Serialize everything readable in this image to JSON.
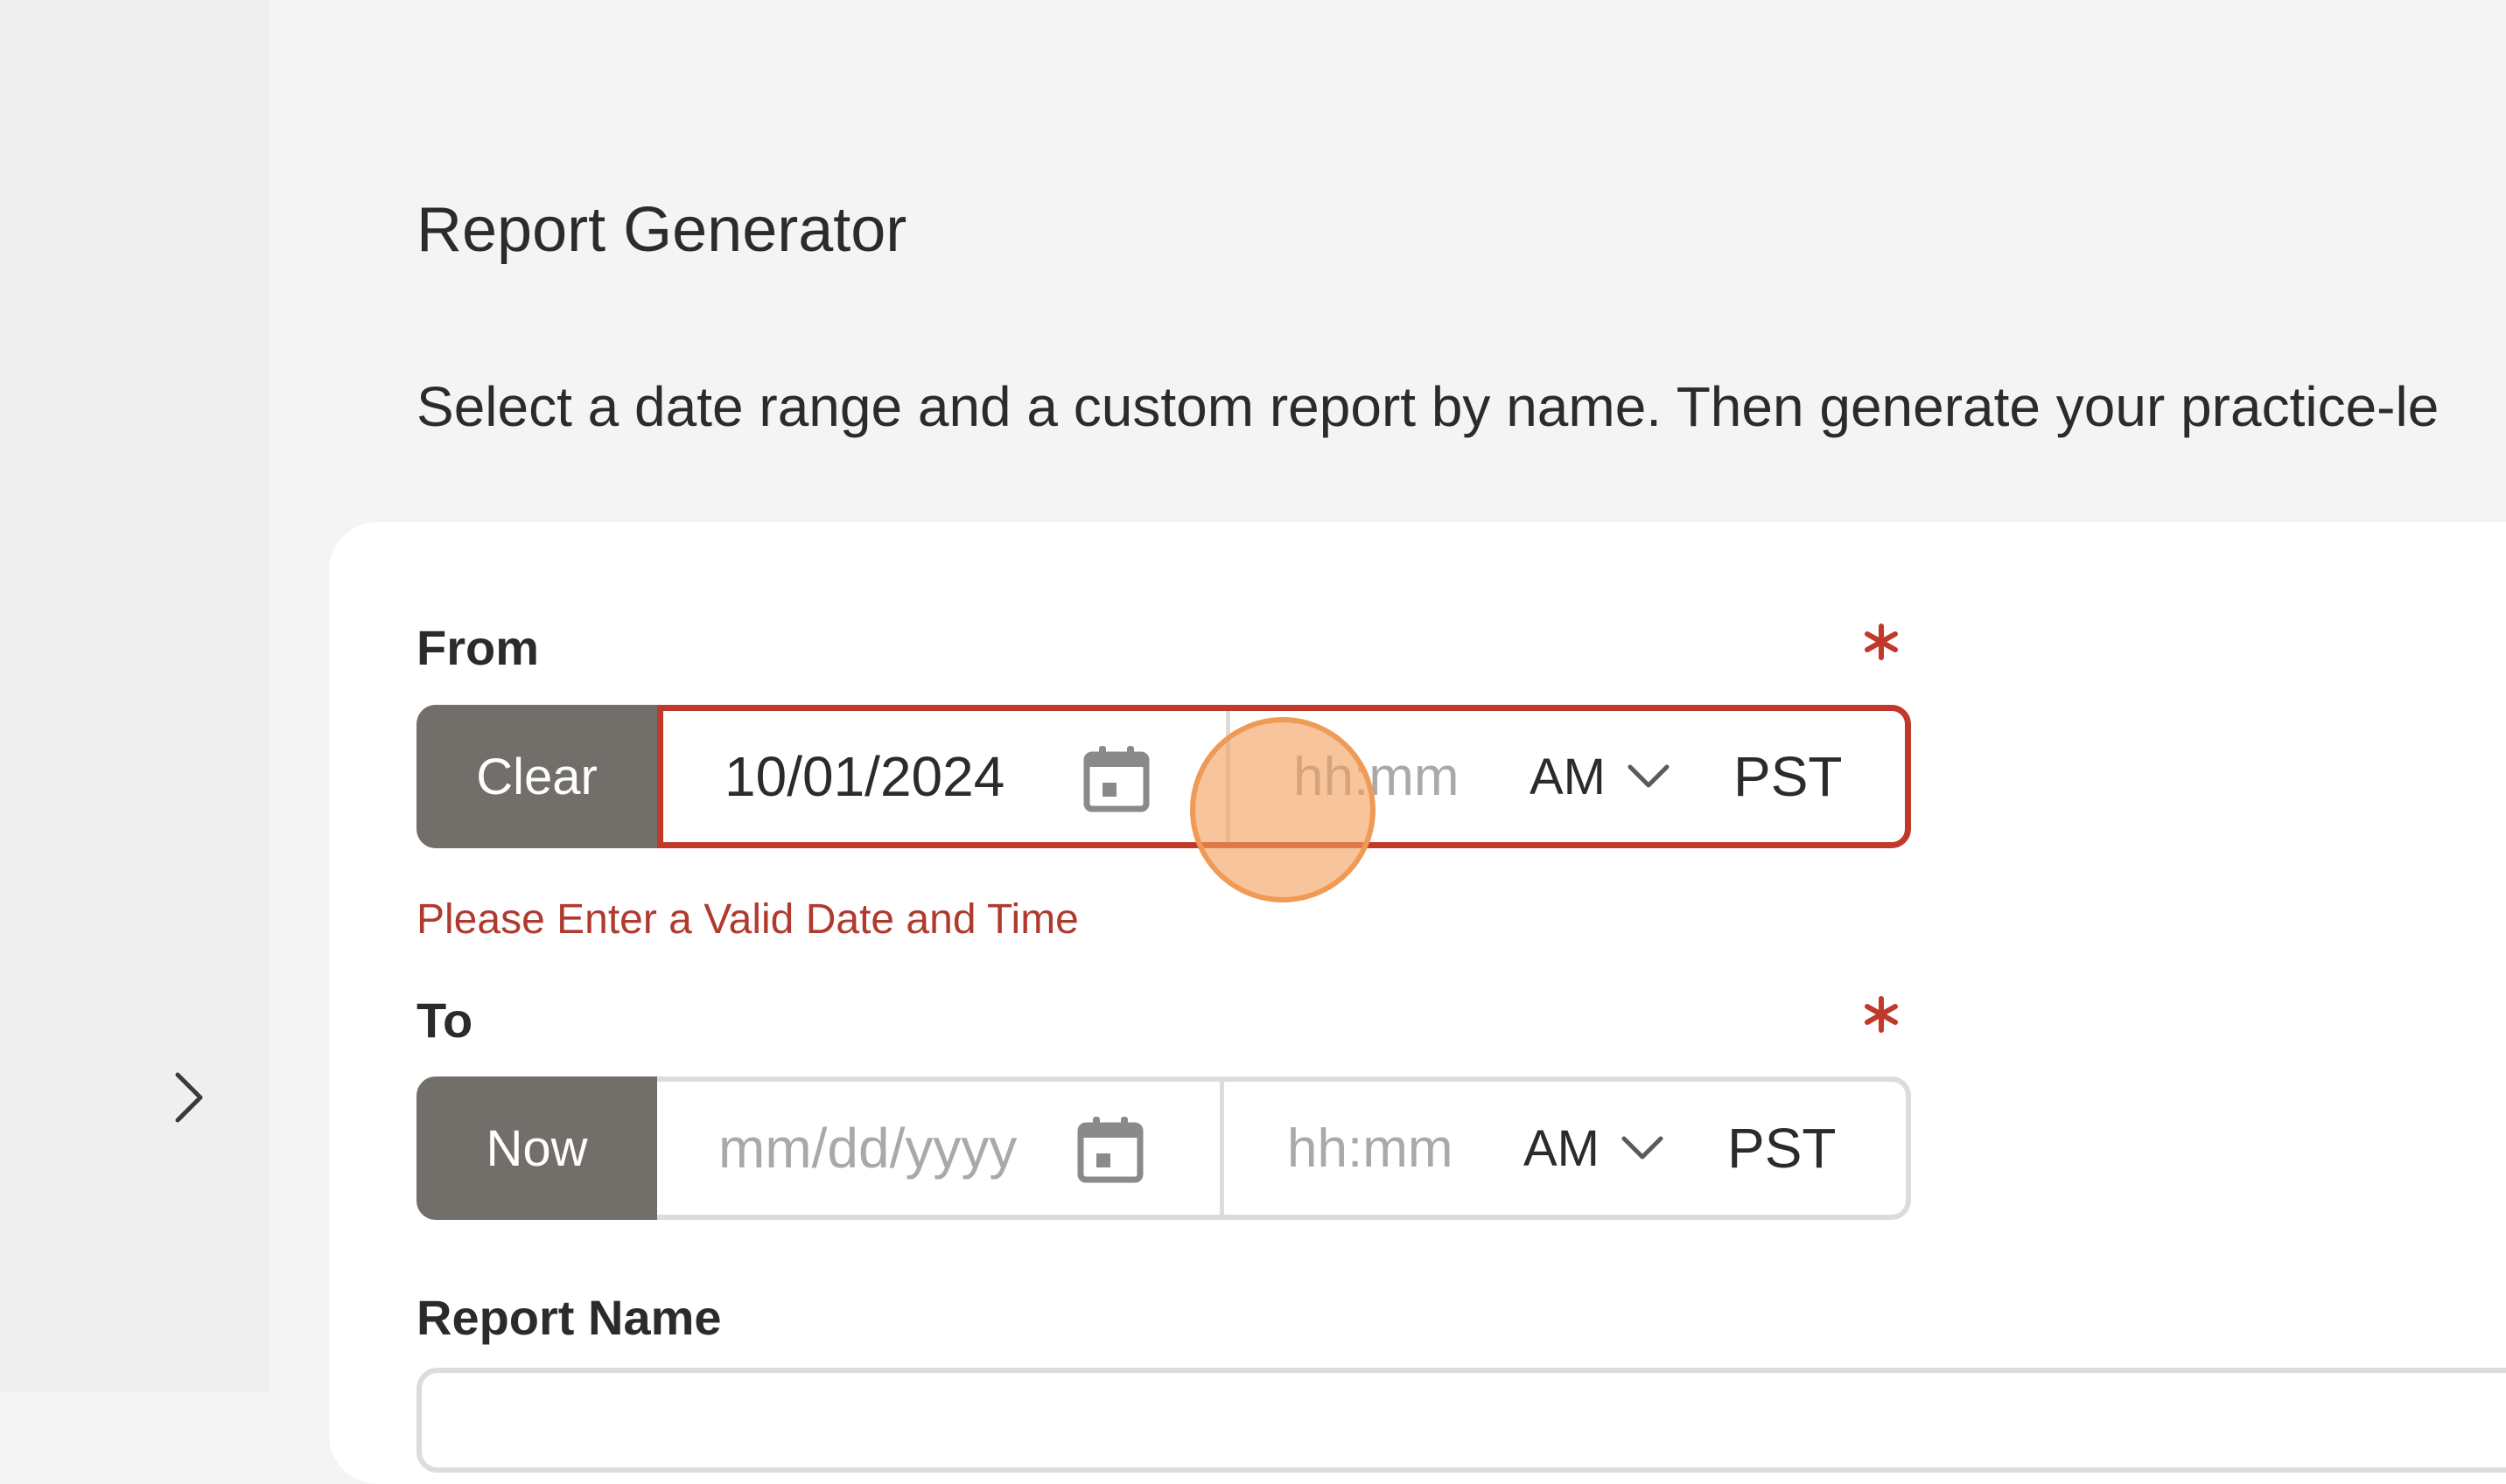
{
  "page": {
    "title": "Report Generator",
    "description": "Select a date range and a custom report by name. Then generate your practice-le"
  },
  "from": {
    "label": "From",
    "button_label": "Clear",
    "date_value": "10/01/2024",
    "time_placeholder": "hh:mm",
    "ampm": "AM",
    "timezone": "PST",
    "error": "Please Enter a Valid Date and Time"
  },
  "to": {
    "label": "To",
    "button_label": "Now",
    "date_placeholder": "mm/dd/yyyy",
    "time_placeholder": "hh:mm",
    "ampm": "AM",
    "timezone": "PST"
  },
  "report": {
    "label": "Report Name"
  },
  "colors": {
    "accent_error": "#c0392b",
    "button_bg": "#726e69",
    "click_indicator": "#f2a060"
  },
  "icons": [
    "chevron-right-icon",
    "calendar-icon",
    "chevron-down-icon",
    "required-asterisk-icon"
  ]
}
